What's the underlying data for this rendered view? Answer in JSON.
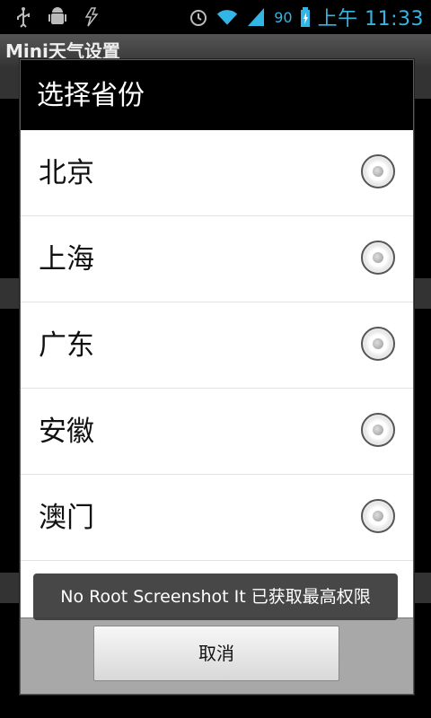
{
  "status_bar": {
    "battery": "90",
    "time": "上午 11:33",
    "icons": [
      "usb-icon",
      "android-debug-icon",
      "lightning-icon",
      "alarm-icon",
      "wifi-icon",
      "signal-icon",
      "battery-icon"
    ]
  },
  "background": {
    "app_title": "Mini天气设置"
  },
  "dialog": {
    "title": "选择省份",
    "items": [
      {
        "label": "北京"
      },
      {
        "label": "上海"
      },
      {
        "label": "广东"
      },
      {
        "label": "安徽"
      },
      {
        "label": "澳门"
      }
    ],
    "cancel_label": "取消"
  },
  "toast": {
    "text": "No Root Screenshot It 已获取最高权限"
  },
  "colors": {
    "status_accent": "#33b5e5",
    "dialog_header": "#000000",
    "dialog_body": "#ffffff",
    "footer": "#a8a8a8"
  }
}
